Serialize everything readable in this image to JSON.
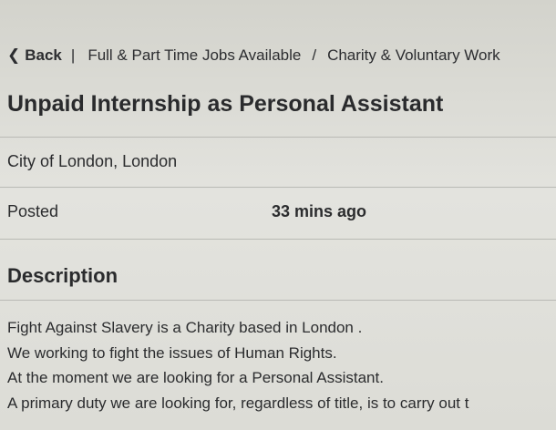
{
  "breadcrumb": {
    "back_label": "Back",
    "separator": "|",
    "crumbs": [
      "Full & Part Time Jobs Available",
      "Charity & Voluntary Work"
    ],
    "divider": "/"
  },
  "job": {
    "title": "Unpaid Internship as Personal Assistant",
    "location": "City of London, London",
    "posted_label": "Posted",
    "posted_value": "33 mins ago"
  },
  "description": {
    "heading": "Description",
    "lines": [
      "Fight Against Slavery is a Charity based in London .",
      "We working to fight the issues of Human Rights.",
      "At the moment we are looking for a Personal Assistant.",
      "A primary duty we are looking for, regardless of title, is to carry out t"
    ]
  },
  "colors": {
    "background": "#dcdcd6",
    "text": "#2b2c2e",
    "divider": "#b9bab5"
  },
  "icons": {
    "back": "chevron-left-icon"
  }
}
